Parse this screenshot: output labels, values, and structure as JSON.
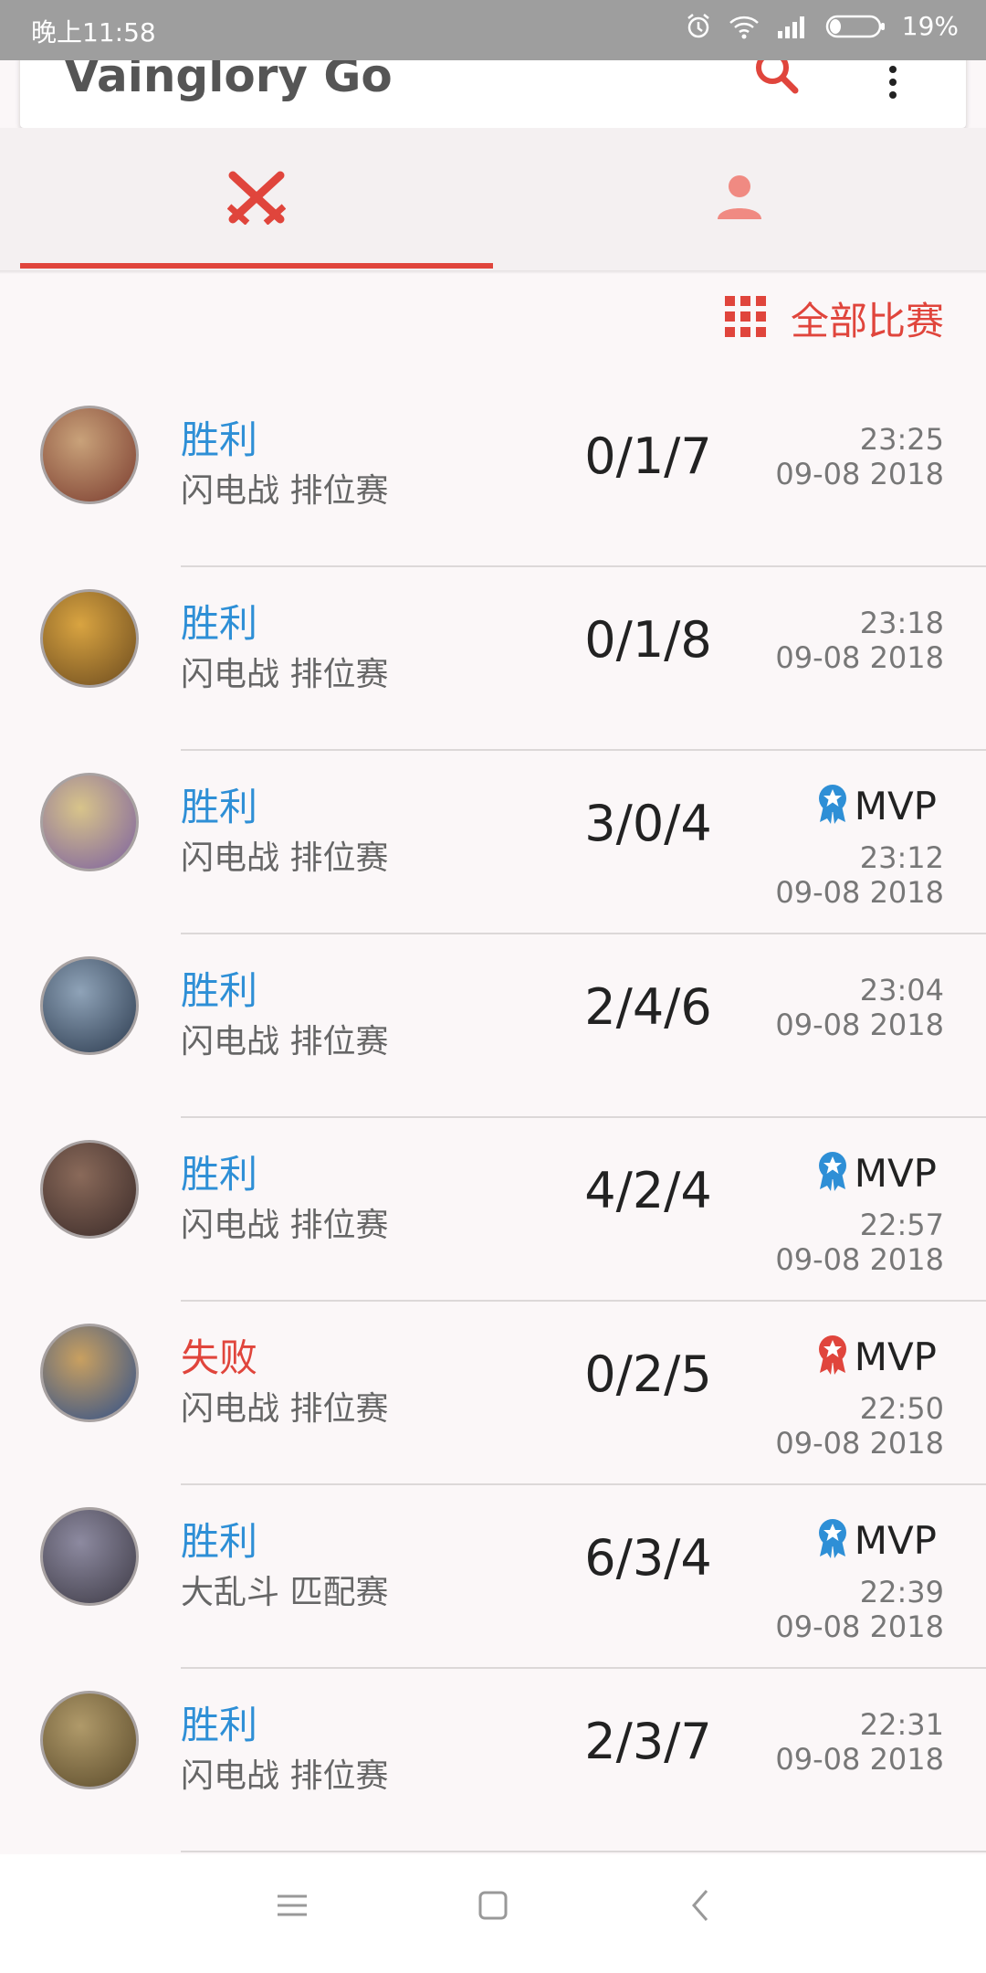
{
  "status": {
    "time": "晚上11:58",
    "battery": "19%"
  },
  "app": {
    "title": "Vainglory Go"
  },
  "filter": {
    "label": "全部比赛"
  },
  "matches": [
    {
      "result": "胜利",
      "outcome": "win",
      "mode": "闪电战 排位赛",
      "kda": "0/1/7",
      "mvp": "",
      "time": "23:25",
      "date": "09-08 2018"
    },
    {
      "result": "胜利",
      "outcome": "win",
      "mode": "闪电战 排位赛",
      "kda": "0/1/8",
      "mvp": "",
      "time": "23:18",
      "date": "09-08 2018"
    },
    {
      "result": "胜利",
      "outcome": "win",
      "mode": "闪电战 排位赛",
      "kda": "3/0/4",
      "mvp": "MVP",
      "time": "23:12",
      "date": "09-08 2018"
    },
    {
      "result": "胜利",
      "outcome": "win",
      "mode": "闪电战 排位赛",
      "kda": "2/4/6",
      "mvp": "",
      "time": "23:04",
      "date": "09-08 2018"
    },
    {
      "result": "胜利",
      "outcome": "win",
      "mode": "闪电战 排位赛",
      "kda": "4/2/4",
      "mvp": "MVP",
      "time": "22:57",
      "date": "09-08 2018"
    },
    {
      "result": "失败",
      "outcome": "loss",
      "mode": "闪电战 排位赛",
      "kda": "0/2/5",
      "mvp": "MVP",
      "time": "22:50",
      "date": "09-08 2018"
    },
    {
      "result": "胜利",
      "outcome": "win",
      "mode": "大乱斗 匹配赛",
      "kda": "6/3/4",
      "mvp": "MVP",
      "time": "22:39",
      "date": "09-08 2018"
    },
    {
      "result": "胜利",
      "outcome": "win",
      "mode": "闪电战 排位赛",
      "kda": "2/3/7",
      "mvp": "",
      "time": "22:31",
      "date": "09-08 2018"
    }
  ],
  "colors": {
    "accent": "#e0453c",
    "win": "#2e8fd6",
    "loss": "#e0453c"
  },
  "icons": [
    "search-icon",
    "more-vert-icon",
    "crossed-swords-icon",
    "person-icon",
    "grid-icon",
    "ribbon-icon",
    "menu-icon",
    "home-icon",
    "back-icon"
  ]
}
